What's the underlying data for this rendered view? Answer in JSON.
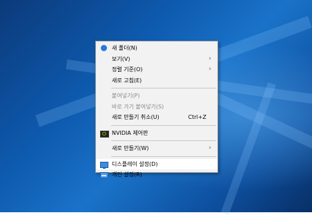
{
  "menu": {
    "items": [
      {
        "label": "새 폴더(N)",
        "icon": "new-folder-icon"
      },
      {
        "label": "보기(V)",
        "submenu": true
      },
      {
        "label": "정렬 기준(O)",
        "submenu": true
      },
      {
        "label": "새로 고침(E)"
      },
      {
        "label": "붙여넣기(P)",
        "disabled": true
      },
      {
        "label": "바로 가기 붙여넣기(S)",
        "disabled": true
      },
      {
        "label": "새로 만들기 취소(U)",
        "shortcut": "Ctrl+Z"
      },
      {
        "label": "NVIDIA 제어판",
        "icon": "nvidia-icon"
      },
      {
        "label": "새로 만들기(W)",
        "submenu": true
      },
      {
        "label": "디스플레이 설정(D)",
        "icon": "display-icon",
        "highlighted": true
      },
      {
        "label": "개인 설정(R)",
        "icon": "personalize-icon"
      }
    ],
    "submenu_arrow": "›"
  }
}
